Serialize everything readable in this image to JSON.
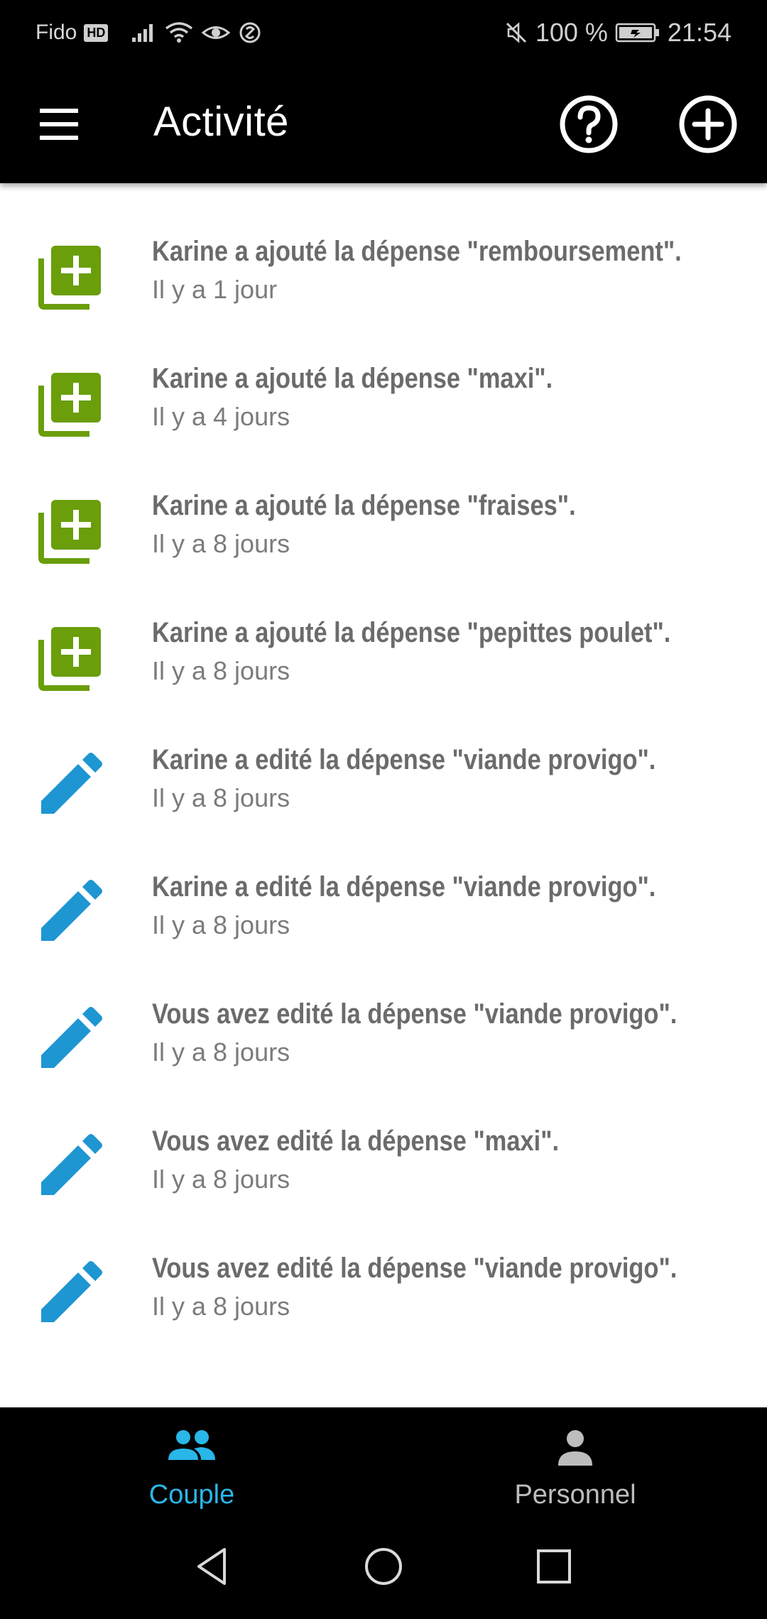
{
  "status_bar": {
    "carrier": "Fido",
    "hd_badge": "HD",
    "battery_text": "100 %",
    "time": "21:54"
  },
  "app_bar": {
    "title": "Activité",
    "menu_icon": "menu-icon",
    "help_icon": "help-circle-icon",
    "add_icon": "add-circle-icon"
  },
  "activities": [
    {
      "type": "added",
      "icon": "add-expense-icon",
      "title": "Karine a ajouté la dépense \"remboursement\".",
      "time": "Il y a 1 jour"
    },
    {
      "type": "added",
      "icon": "add-expense-icon",
      "title": "Karine a ajouté la dépense \"maxi\".",
      "time": "Il y a 4 jours"
    },
    {
      "type": "added",
      "icon": "add-expense-icon",
      "title": "Karine a ajouté la dépense \"fraises\".",
      "time": "Il y a 8 jours"
    },
    {
      "type": "added",
      "icon": "add-expense-icon",
      "title": "Karine a ajouté la dépense \"pepittes poulet\".",
      "time": "Il y a 8 jours"
    },
    {
      "type": "edited",
      "icon": "pencil-icon",
      "title": "Karine a edité la dépense \"viande provigo\".",
      "time": "Il y a 8 jours"
    },
    {
      "type": "edited",
      "icon": "pencil-icon",
      "title": "Karine a edité la dépense \"viande provigo\".",
      "time": "Il y a 8 jours"
    },
    {
      "type": "edited",
      "icon": "pencil-icon",
      "title": "Vous avez edité la dépense \"viande provigo\".",
      "time": "Il y a 8 jours"
    },
    {
      "type": "edited",
      "icon": "pencil-icon",
      "title": "Vous avez edité la dépense \"maxi\".",
      "time": "Il y a 8 jours"
    },
    {
      "type": "edited",
      "icon": "pencil-icon",
      "title": "Vous avez edité la dépense \"viande provigo\".",
      "time": "Il y a 8 jours"
    }
  ],
  "bottom_nav": {
    "tabs": [
      {
        "label": "Couple",
        "icon": "people-icon",
        "active": true
      },
      {
        "label": "Personnel",
        "icon": "person-icon",
        "active": false
      }
    ]
  },
  "colors": {
    "add_green": "#6a9e0a",
    "edit_blue": "#1e96d2",
    "active_tab": "#29b6e8",
    "inactive_tab": "#bdbdbd"
  }
}
